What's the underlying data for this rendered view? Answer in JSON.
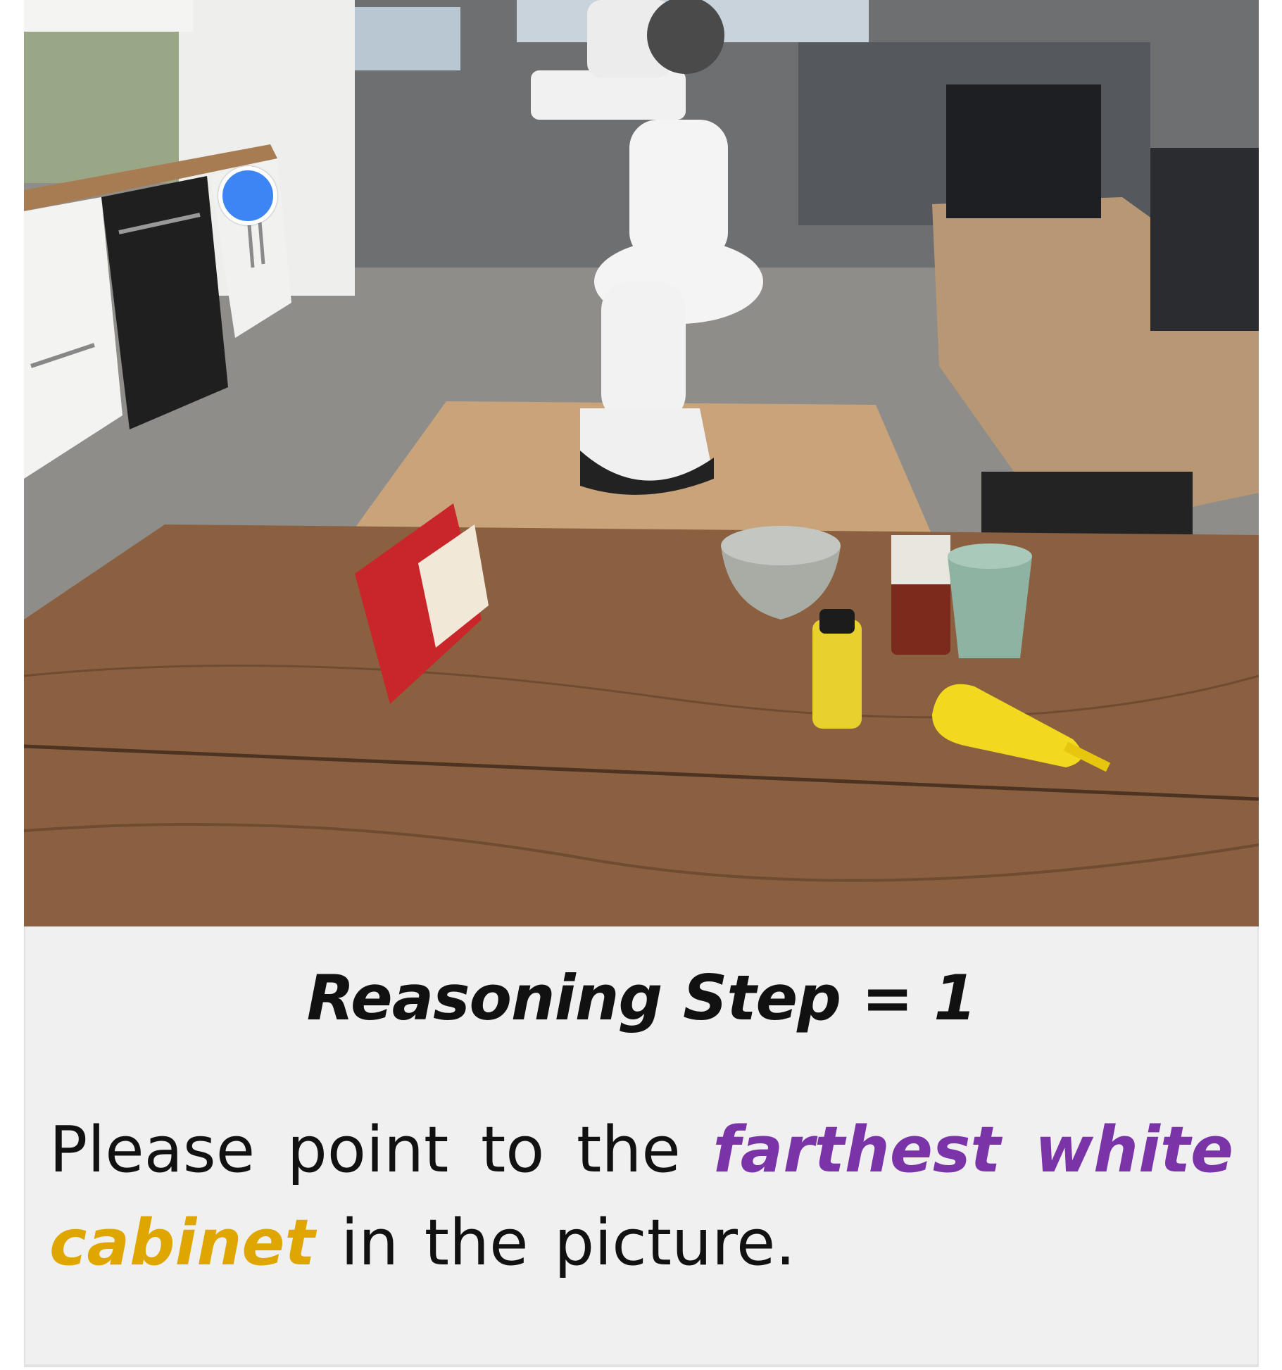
{
  "caption": {
    "title": "Reasoning Step = 1",
    "prompt_before": "Please point to the",
    "prompt_highlight_purple": "farthest white",
    "prompt_highlight_gold": "cabinet",
    "prompt_after": "in the picture."
  },
  "colors": {
    "marker": "#3d85f2",
    "highlight_purple": "#7a34a8",
    "highlight_gold": "#e0a600",
    "panel_background": "#f0f0f0"
  }
}
